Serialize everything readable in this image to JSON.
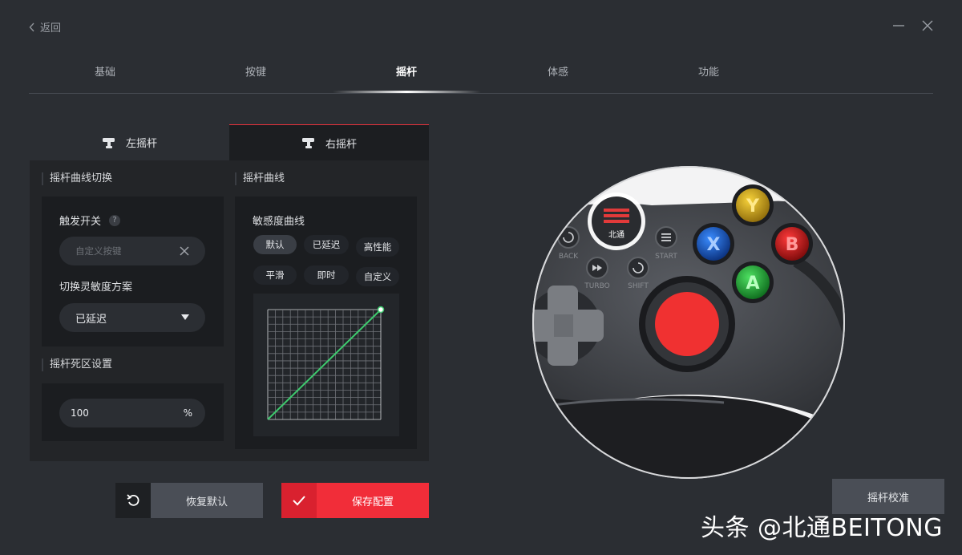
{
  "nav": {
    "back_label": "返回"
  },
  "tabs": [
    {
      "label": "基础"
    },
    {
      "label": "按键"
    },
    {
      "label": "摇杆"
    },
    {
      "label": "体感"
    },
    {
      "label": "功能"
    }
  ],
  "stick_tabs": {
    "left": "左摇杆",
    "right": "右摇杆"
  },
  "curve_switch": {
    "title": "摇杆曲线切换",
    "trigger_label": "触发开关",
    "help": "?",
    "custom_key_placeholder": "自定义按键",
    "scheme_label": "切换灵敏度方案",
    "scheme_value": "已延迟"
  },
  "deadzone": {
    "title": "摇杆死区设置",
    "value": "100",
    "unit": "%"
  },
  "curve": {
    "title": "摇杆曲线",
    "subtitle": "敏感度曲线",
    "presets": [
      "默认",
      "已延迟",
      "高性能",
      "平滑",
      "即时",
      "自定义"
    ],
    "selected": "默认",
    "line_color": "#3ecb6e"
  },
  "buttons": {
    "restore_label": "恢复默认",
    "save_label": "保存配置",
    "calibrate_label": "摇杆校准"
  },
  "controller": {
    "logo_text": "北通",
    "back_label": "BACK",
    "start_label": "START",
    "turbo_label": "TURBO",
    "shift_label": "SHIFT",
    "y": "Y",
    "x": "X",
    "b": "B",
    "a": "A",
    "highlight_color": "#f03131"
  },
  "watermark": "头条 @北通BEITONG"
}
